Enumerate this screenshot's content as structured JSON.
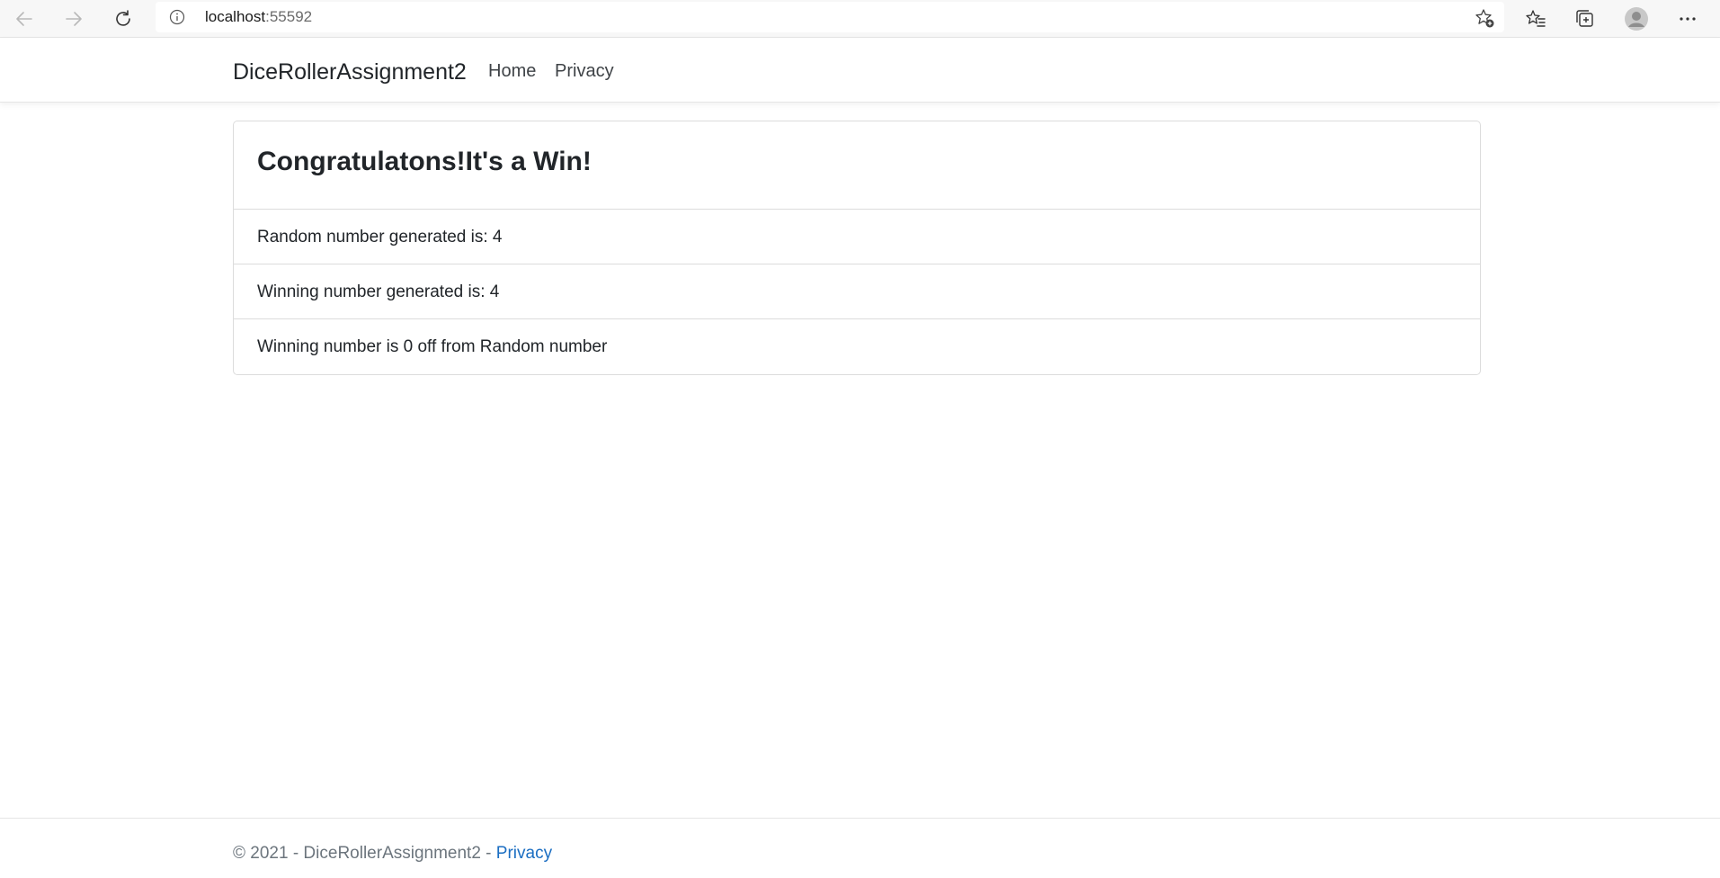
{
  "browser": {
    "url_host": "localhost",
    "url_port": ":55592",
    "icons": {
      "back": "back-arrow-icon",
      "forward": "forward-arrow-icon",
      "refresh": "refresh-icon",
      "info": "info-icon",
      "add_favorite": "add-favorite-icon",
      "favorites": "favorites-icon",
      "collections": "collections-icon",
      "profile": "profile-avatar-icon",
      "more": "more-options-icon"
    }
  },
  "navbar": {
    "brand": "DiceRollerAssignment2",
    "links": [
      {
        "label": "Home"
      },
      {
        "label": "Privacy"
      }
    ]
  },
  "result": {
    "title": "Congratulatons!It's a Win!",
    "items": [
      "Random number generated is: 4",
      "Winning number generated is: 4",
      "Winning number is 0 off from Random number"
    ]
  },
  "footer": {
    "text": "© 2021 - DiceRollerAssignment2 - ",
    "link": "Privacy"
  },
  "colors": {
    "link_blue": "#1b6ec2",
    "text": "#212529",
    "muted": "#6c757d",
    "border": "#dcdcdc"
  }
}
